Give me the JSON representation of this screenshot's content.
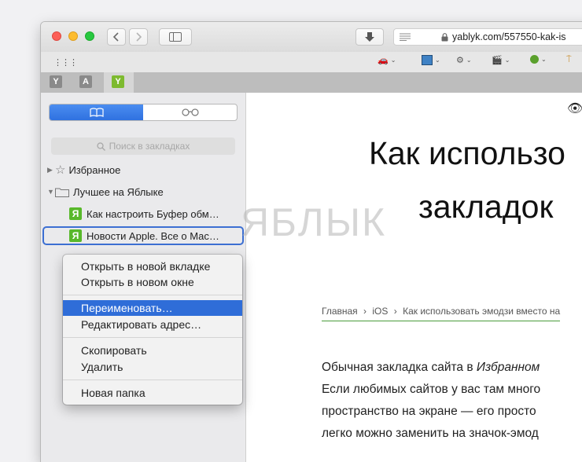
{
  "url": "yablyk.com/557550-kak-is",
  "sidebar": {
    "search_placeholder": "Поиск в закладках",
    "items": [
      {
        "label": "Избранное"
      },
      {
        "label": "Лучшее на Яблыке"
      },
      {
        "label": "Как настроить Буфер обм…",
        "favicon": "Я"
      },
      {
        "label": "Новости Apple. Все о Mac…",
        "favicon": "Я"
      }
    ]
  },
  "tabs": [
    {
      "glyph": "Y",
      "color": "#8a8a8a"
    },
    {
      "glyph": "A",
      "color": "#8a8a8a"
    },
    {
      "glyph": "Y",
      "color": "#7dba2f"
    }
  ],
  "context_menu": {
    "items": [
      "Открыть в новой вкладке",
      "Открыть в новом окне",
      "Переименовать…",
      "Редактировать адрес…",
      "Скопировать",
      "Удалить",
      "Новая папка"
    ],
    "highlighted": "Переименовать…"
  },
  "article": {
    "title_line1": "Как использо",
    "title_line2": "закладок",
    "breadcrumb": {
      "home": "Главная",
      "section": "iOS",
      "current": "Как использовать эмодзи вместо на"
    },
    "para_line1_prefix": "Обычная закладка сайта в ",
    "para_line1_italic": "Избранном",
    "para_line2": "Если любимых сайтов у вас там много",
    "para_line3": "пространство на экране — его просто",
    "para_line4": "легко можно заменить на значок-эмод"
  },
  "watermark": "ЯБЛЫК",
  "colors": {
    "accent": "#2f6dd8",
    "favicon": "#58b82a"
  }
}
